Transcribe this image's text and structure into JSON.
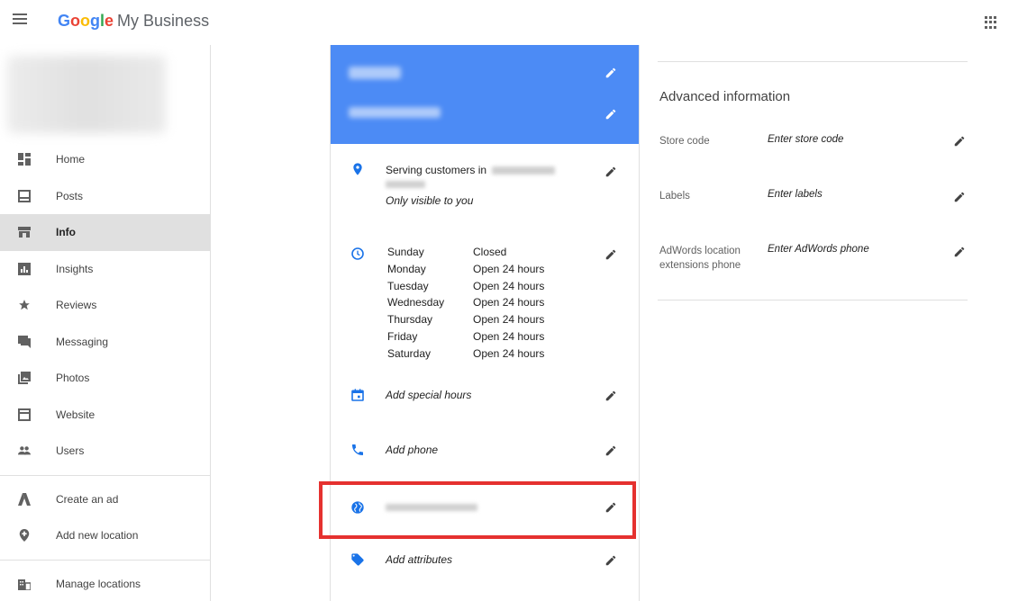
{
  "app": {
    "brand_letters": [
      "G",
      "o",
      "o",
      "g",
      "l",
      "e"
    ],
    "product": "My Business"
  },
  "icons": {
    "menu": "hamburger-icon",
    "apps": "apps-grid-icon",
    "edit": "pencil-icon"
  },
  "sidebar": {
    "items": [
      {
        "label": "Home",
        "icon": "dashboard-icon",
        "active": false
      },
      {
        "label": "Posts",
        "icon": "posts-icon",
        "active": false
      },
      {
        "label": "Info",
        "icon": "storefront-icon",
        "active": true
      },
      {
        "label": "Insights",
        "icon": "insights-icon",
        "active": false
      },
      {
        "label": "Reviews",
        "icon": "star-icon",
        "active": false
      },
      {
        "label": "Messaging",
        "icon": "chat-icon",
        "active": false
      },
      {
        "label": "Photos",
        "icon": "photos-icon",
        "active": false
      },
      {
        "label": "Website",
        "icon": "website-icon",
        "active": false
      },
      {
        "label": "Users",
        "icon": "users-icon",
        "active": false
      }
    ],
    "secondary": [
      {
        "label": "Create an ad",
        "icon": "adwords-icon"
      },
      {
        "label": "Add new location",
        "icon": "add-location-icon"
      }
    ],
    "tertiary": [
      {
        "label": "Manage locations",
        "icon": "locations-icon"
      }
    ]
  },
  "info": {
    "service_area": {
      "label": "Serving customers in",
      "note": "Only visible to you"
    },
    "hours": [
      {
        "day": "Sunday",
        "value": "Closed"
      },
      {
        "day": "Monday",
        "value": "Open 24 hours"
      },
      {
        "day": "Tuesday",
        "value": "Open 24 hours"
      },
      {
        "day": "Wednesday",
        "value": "Open 24 hours"
      },
      {
        "day": "Thursday",
        "value": "Open 24 hours"
      },
      {
        "day": "Friday",
        "value": "Open 24 hours"
      },
      {
        "day": "Saturday",
        "value": "Open 24 hours"
      }
    ],
    "special_hours": "Add special hours",
    "phone": "Add phone",
    "attributes": "Add attributes"
  },
  "advanced": {
    "title": "Advanced information",
    "rows": [
      {
        "label": "Store code",
        "value": "Enter store code"
      },
      {
        "label": "Labels",
        "value": "Enter labels"
      },
      {
        "label": "AdWords location extensions phone",
        "value": "Enter AdWords phone"
      }
    ]
  },
  "colors": {
    "header_blue": "#4c8bf5",
    "icon_blue": "#1a73e8",
    "highlight_red": "#e5312f"
  }
}
